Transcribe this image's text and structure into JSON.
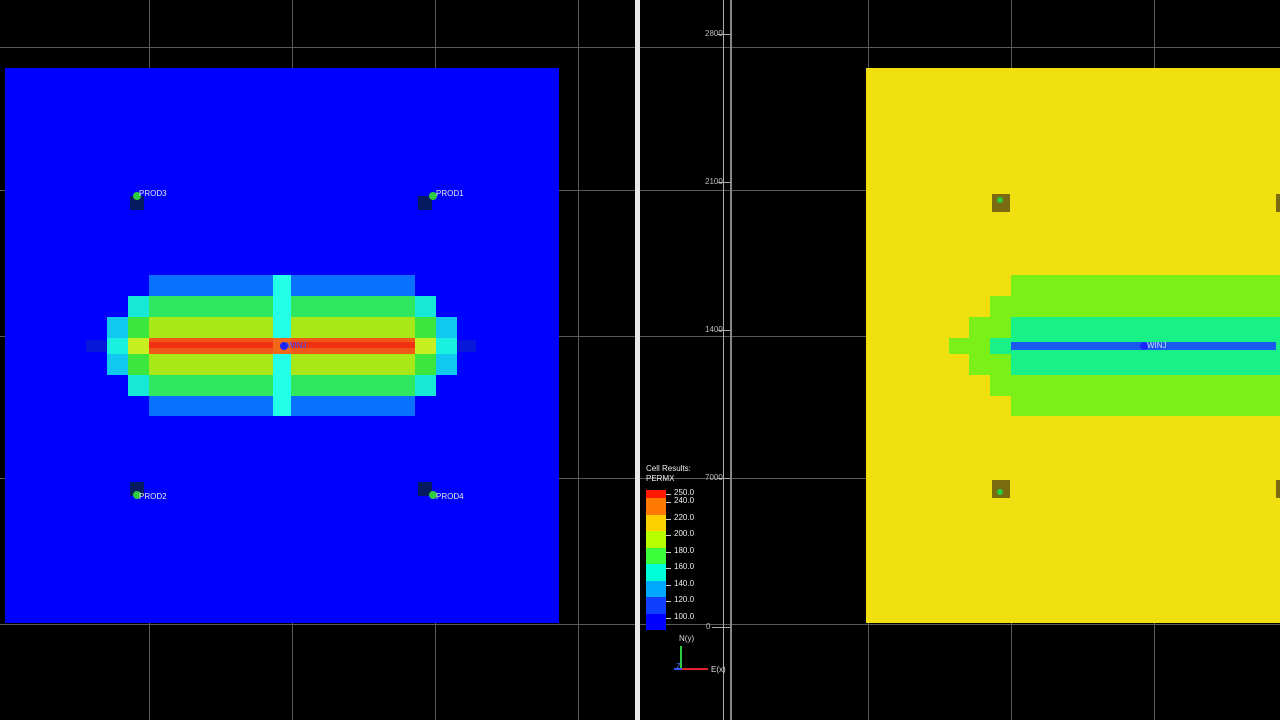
{
  "left_view": {
    "wells": [
      {
        "name": "PROD3"
      },
      {
        "name": "PROD1"
      },
      {
        "name": "PROD2"
      },
      {
        "name": "PROD4"
      }
    ],
    "injector": {
      "name": "WINJ"
    }
  },
  "right_view": {
    "injector": {
      "name": "WINJ"
    },
    "y_axis_ticks": [
      "2800",
      "2100",
      "1400",
      "7000",
      "0"
    ]
  },
  "legend": {
    "title_line1": "Cell Results:",
    "title_line2": "PERMX",
    "labels": [
      "250.0",
      "240.0",
      "220.0",
      "200.0",
      "180.0",
      "160.0",
      "140.0",
      "120.0",
      "100.0"
    ],
    "colors": [
      "#ff1a00",
      "#ff7a00",
      "#ffd000",
      "#b8ff00",
      "#3cff3c",
      "#00ffd8",
      "#00a8ff",
      "#1040ff",
      "#0000ff"
    ]
  },
  "axis_triad": {
    "y_label": "N(y)",
    "x_label": "E(x)",
    "z_label": "Z"
  },
  "colors": {
    "background": "#000000",
    "left_base": "#0000ff",
    "right_base": "#f0e010"
  }
}
